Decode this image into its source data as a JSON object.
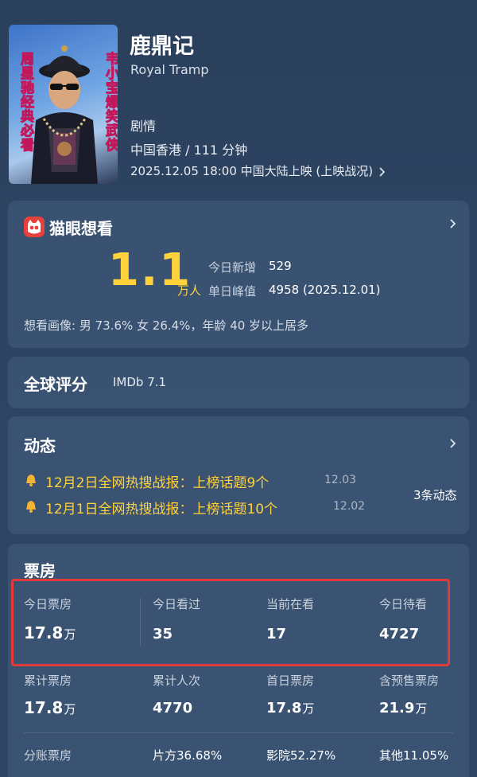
{
  "movie": {
    "title": "鹿鼎记",
    "subtitle": "Royal Tramp",
    "genre": "剧情",
    "region_runtime": "中国香港 / 111 分钟",
    "release": "2025.12.05 18:00 中国大陆上映 (上映战况)",
    "poster": {
      "left_text": "周星驰经典必看",
      "right_text": "韦小宝爆笑武侠"
    }
  },
  "want": {
    "title": "猫眼想看",
    "count": "1.1",
    "unit": "万人",
    "today_label": "今日新增",
    "today_value": "529",
    "peak_label": "单日峰值",
    "peak_value": "4958 (2025.12.01)",
    "portrait": "想看画像: 男 73.6%  女 26.4%，年龄 40 岁以上居多"
  },
  "rating": {
    "title": "全球评分",
    "imdb": "IMDb 7.1"
  },
  "dynamic": {
    "title": "动态",
    "count": "3条动态",
    "items": [
      {
        "text": "12月2日全网热搜战报：上榜话题9个",
        "date": "12.03"
      },
      {
        "text": "12月1日全网热搜战报：上榜话题10个",
        "date": "12.02"
      }
    ]
  },
  "boxoffice": {
    "title": "票房",
    "row1": [
      {
        "label": "今日票房",
        "value": "17.8",
        "unit": "万"
      },
      {
        "label": "今日看过",
        "value": "35",
        "unit": ""
      },
      {
        "label": "当前在看",
        "value": "17",
        "unit": ""
      },
      {
        "label": "今日待看",
        "value": "4727",
        "unit": ""
      }
    ],
    "row2": [
      {
        "label": "累计票房",
        "value": "17.8",
        "unit": "万"
      },
      {
        "label": "累计人次",
        "value": "4770",
        "unit": ""
      },
      {
        "label": "首日票房",
        "value": "17.8",
        "unit": "万"
      },
      {
        "label": "含预售票房",
        "value": "21.9",
        "unit": "万"
      }
    ],
    "row3": [
      {
        "label": "分账票房"
      },
      {
        "label": "片方36.68%"
      },
      {
        "label": "影院52.27%"
      },
      {
        "label": "其他11.05%"
      }
    ]
  },
  "colors": {
    "accent": "#ffd23c",
    "highlight_border": "#e03a3a",
    "background": "#2d4462"
  }
}
